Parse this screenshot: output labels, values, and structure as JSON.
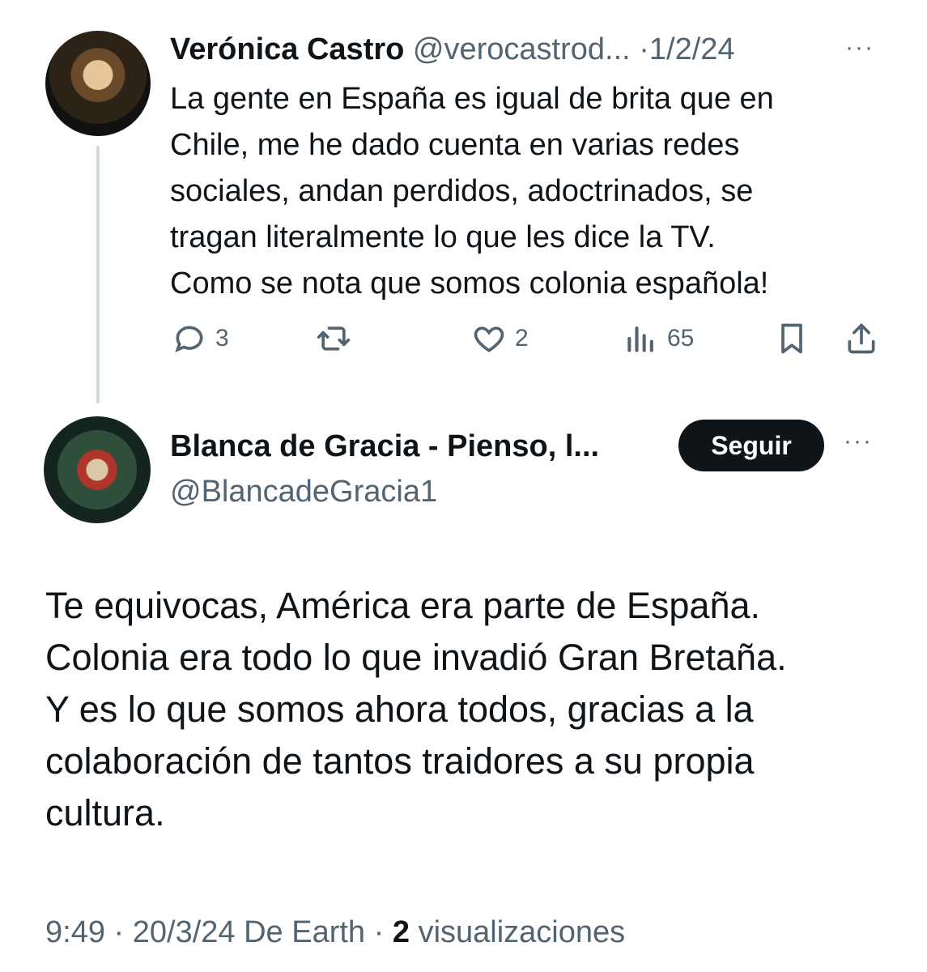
{
  "parent_tweet": {
    "name": "Verónica Castro",
    "handle": "@verocastrod...",
    "separator": "·",
    "date": "1/2/24",
    "more": "···",
    "text_lines": [
      "La gente en España es igual de brita que en",
      "Chile, me he dado cuenta en varias redes",
      "sociales, andan perdidos, adoctrinados, se",
      "tragan literalmente lo que les dice la TV.",
      "Como se nota que somos colonia española!"
    ],
    "actions": {
      "replies": "3",
      "retweets": "",
      "likes": "2",
      "views": "65"
    },
    "icons": [
      "reply-icon",
      "retweet-icon",
      "like-icon",
      "views-icon",
      "bookmark-icon",
      "share-icon"
    ]
  },
  "reply_tweet": {
    "name": "Blanca de Gracia - Pienso, l...",
    "handle": "@BlancadeGracia1",
    "follow_label": "Seguir",
    "more": "···",
    "text_lines": [
      "Te equivocas, América era parte de España.",
      "Colonia era todo lo que invadió Gran Bretaña.",
      "Y es lo que somos ahora todos, gracias a la",
      "colaboración de tantos traidores a su propia",
      "cultura."
    ],
    "meta": {
      "time": "9:49",
      "sep1": "·",
      "date": "20/3/24",
      "source": "De Earth",
      "sep2": "·",
      "views_count": "2",
      "views_label": "visualizaciones"
    }
  },
  "colors": {
    "text": "#0f1419",
    "muted": "#536471",
    "thread_line": "#cfd9de",
    "follow_bg": "#0f1419"
  }
}
